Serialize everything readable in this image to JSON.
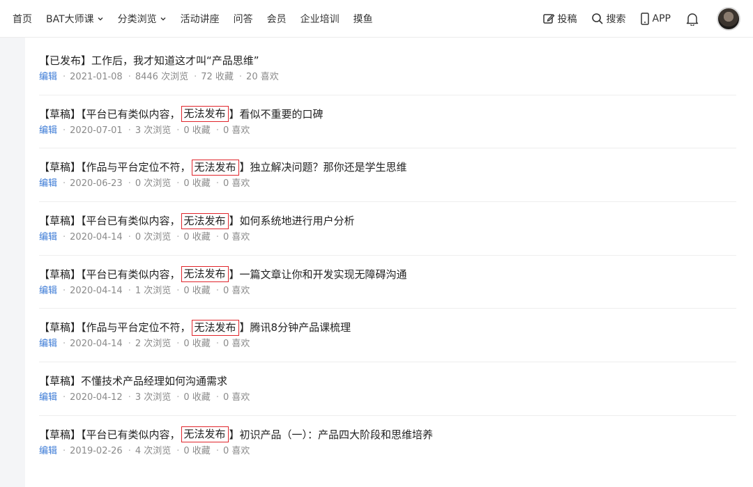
{
  "nav": {
    "items": [
      {
        "label": "首页",
        "dropdown": false
      },
      {
        "label": "BAT大师课",
        "dropdown": true
      },
      {
        "label": "分类浏览",
        "dropdown": true
      },
      {
        "label": "活动讲座",
        "dropdown": false
      },
      {
        "label": "问答",
        "dropdown": false
      },
      {
        "label": "会员",
        "dropdown": false
      },
      {
        "label": "企业培训",
        "dropdown": false
      },
      {
        "label": "摸鱼",
        "dropdown": false
      }
    ]
  },
  "header_right": {
    "submit_label": "投稿",
    "search_label": "搜索",
    "app_label": "APP"
  },
  "colors": {
    "accent": "#3c7bd6",
    "badge_border": "#e0242a",
    "meta": "#8a8a8a"
  },
  "articles": [
    {
      "prefix": "【已发布】",
      "reason": "",
      "badge": "",
      "suffix": "工作后，我才知道这才叫“产品思维”",
      "edit": "编辑",
      "date": "2021-01-08",
      "views": "8446 次浏览",
      "favs": "72 收藏",
      "likes": "20 喜欢"
    },
    {
      "prefix": "【草稿】【平台已有类似内容，",
      "badge": "无法发布",
      "suffix": "】看似不重要的口碑",
      "edit": "编辑",
      "date": "2020-07-01",
      "views": "3 次浏览",
      "favs": "0 收藏",
      "likes": "0 喜欢"
    },
    {
      "prefix": "【草稿】【作品与平台定位不符，",
      "badge": "无法发布",
      "suffix": "】独立解决问题？那你还是学生思维",
      "edit": "编辑",
      "date": "2020-06-23",
      "views": "0 次浏览",
      "favs": "0 收藏",
      "likes": "0 喜欢"
    },
    {
      "prefix": "【草稿】【平台已有类似内容，",
      "badge": "无法发布",
      "suffix": "】如何系统地进行用户分析",
      "edit": "编辑",
      "date": "2020-04-14",
      "views": "0 次浏览",
      "favs": "0 收藏",
      "likes": "0 喜欢"
    },
    {
      "prefix": "【草稿】【平台已有类似内容，",
      "badge": "无法发布",
      "suffix": "】一篇文章让你和开发实现无障碍沟通",
      "edit": "编辑",
      "date": "2020-04-14",
      "views": "1 次浏览",
      "favs": "0 收藏",
      "likes": "0 喜欢"
    },
    {
      "prefix": "【草稿】【作品与平台定位不符，",
      "badge": "无法发布",
      "suffix": "】腾讯8分钟产品课梳理",
      "edit": "编辑",
      "date": "2020-04-14",
      "views": "2 次浏览",
      "favs": "0 收藏",
      "likes": "0 喜欢"
    },
    {
      "prefix": "【草稿】",
      "badge": "",
      "suffix": "不懂技术产品经理如何沟通需求",
      "edit": "编辑",
      "date": "2020-04-12",
      "views": "3 次浏览",
      "favs": "0 收藏",
      "likes": "0 喜欢"
    },
    {
      "prefix": "【草稿】【平台已有类似内容，",
      "badge": "无法发布",
      "suffix": "】初识产品（一）：产品四大阶段和思维培养",
      "edit": "编辑",
      "date": "2019-02-26",
      "views": "4 次浏览",
      "favs": "0 收藏",
      "likes": "0 喜欢"
    }
  ]
}
